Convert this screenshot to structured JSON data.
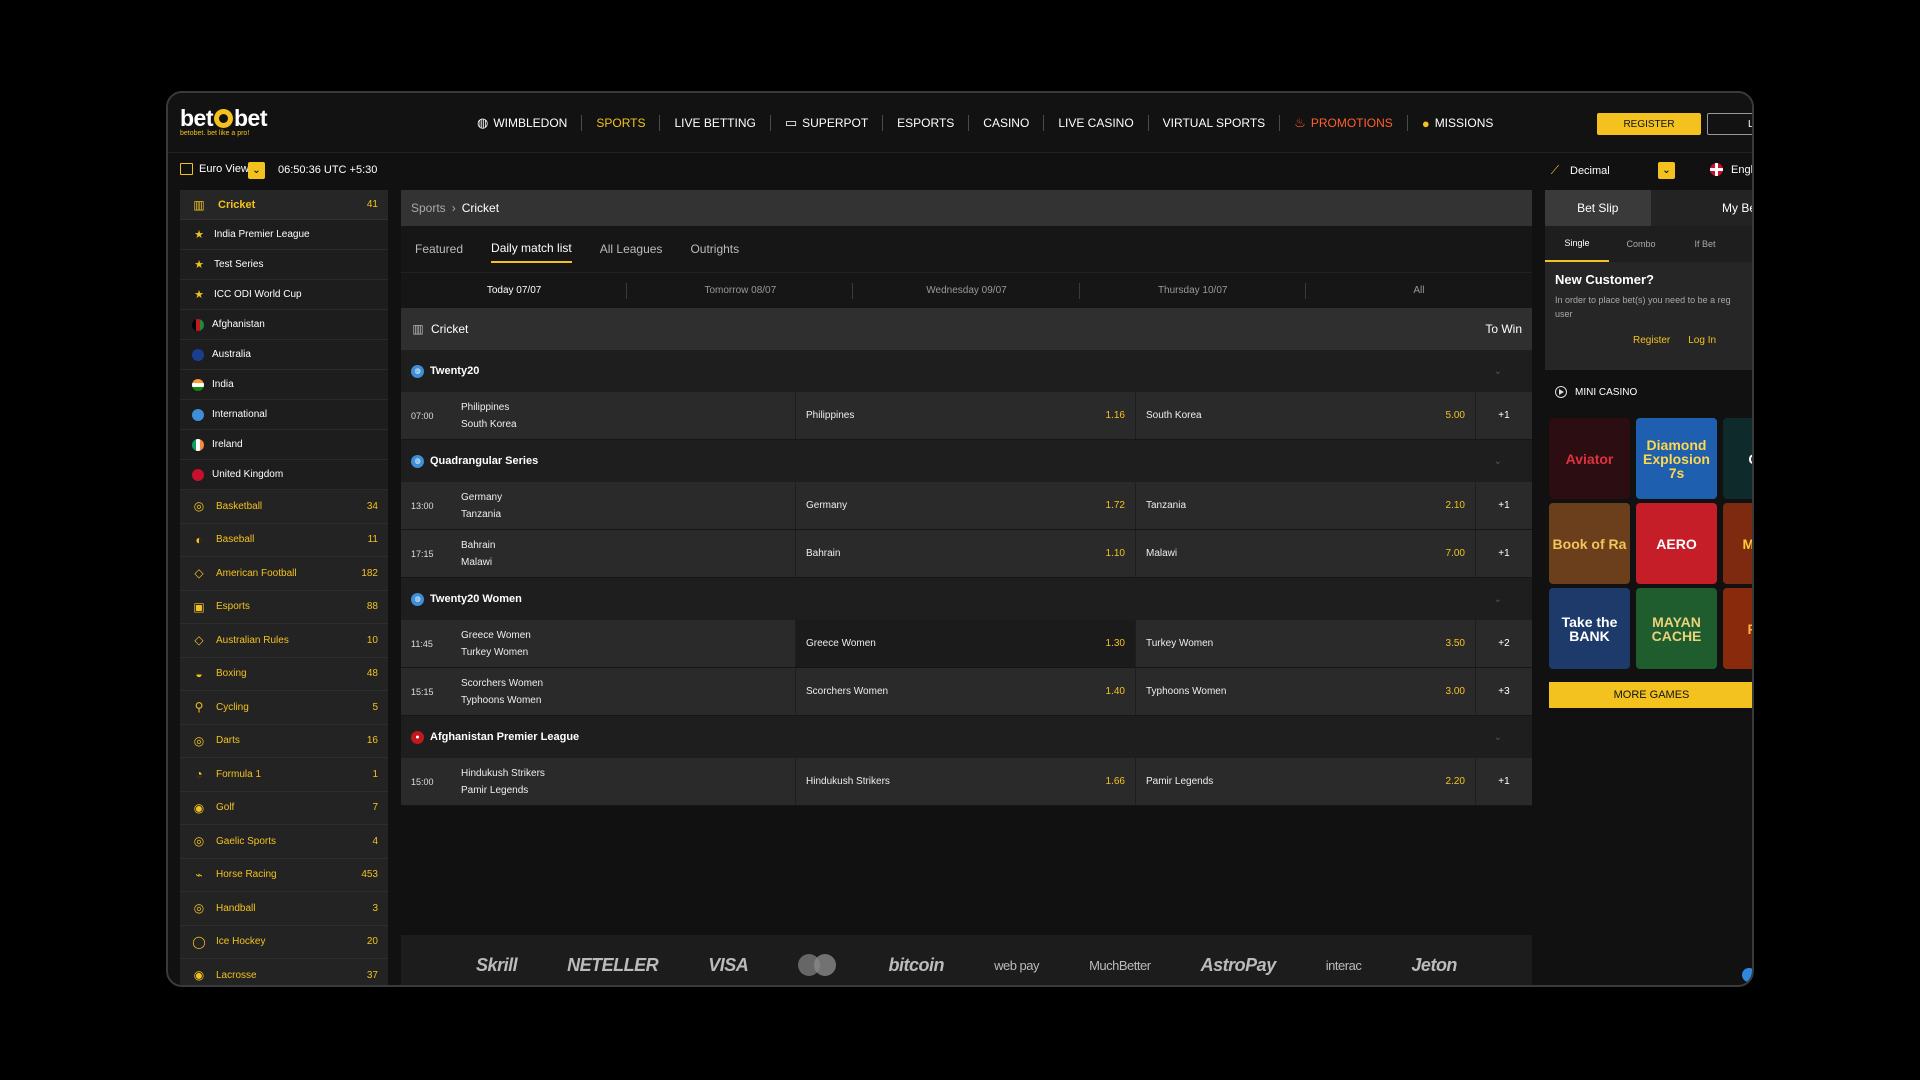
{
  "brand": {
    "name": "betobet",
    "name_left": "bet",
    "name_right": "bet",
    "tagline": "betobet. bet like a pro!",
    "accent": "#f3c21f"
  },
  "nav": [
    {
      "label": "WIMBLEDON",
      "icon": "tennis-ball-icon"
    },
    {
      "label": "SPORTS",
      "active": true
    },
    {
      "label": "LIVE BETTING"
    },
    {
      "label": "SUPERPOT",
      "icon": "ticket-icon"
    },
    {
      "label": "ESPORTS"
    },
    {
      "label": "CASINO"
    },
    {
      "label": "LIVE CASINO"
    },
    {
      "label": "VIRTUAL SPORTS"
    },
    {
      "label": "PROMOTIONS",
      "icon": "flame-icon",
      "color": "#ff5f2e"
    },
    {
      "label": "MISSIONS",
      "icon": "coin-icon"
    }
  ],
  "auth": {
    "register": "REGISTER",
    "login": "LO"
  },
  "subbar": {
    "view": "Euro View",
    "time": "06:50:36 UTC +5:30",
    "odds_format": "Decimal",
    "language": "Engli"
  },
  "sidebar": {
    "current": {
      "name": "Cricket",
      "count": "41",
      "icon": "cricket-icon"
    },
    "subitems": [
      {
        "name": "India Premier League",
        "icon": "star-icon"
      },
      {
        "name": "Test Series",
        "icon": "star-icon"
      },
      {
        "name": "ICC ODI World Cup",
        "icon": "star-icon"
      },
      {
        "name": "Afghanistan",
        "icon": "flag-afghanistan-icon"
      },
      {
        "name": "Australia",
        "icon": "flag-australia-icon"
      },
      {
        "name": "India",
        "icon": "flag-india-icon"
      },
      {
        "name": "International",
        "icon": "globe-icon"
      },
      {
        "name": "Ireland",
        "icon": "flag-ireland-icon"
      },
      {
        "name": "United Kingdom",
        "icon": "flag-uk-icon"
      }
    ],
    "sports": [
      {
        "name": "Basketball",
        "count": "34",
        "icon": "basketball-icon"
      },
      {
        "name": "Baseball",
        "count": "11",
        "icon": "baseball-icon"
      },
      {
        "name": "American Football",
        "count": "182",
        "icon": "american-football-icon"
      },
      {
        "name": "Esports",
        "count": "88",
        "icon": "gamepad-icon"
      },
      {
        "name": "Australian Rules",
        "count": "10",
        "icon": "aussie-rules-icon"
      },
      {
        "name": "Boxing",
        "count": "48",
        "icon": "boxing-glove-icon"
      },
      {
        "name": "Cycling",
        "count": "5",
        "icon": "bicycle-icon"
      },
      {
        "name": "Darts",
        "count": "16",
        "icon": "dartboard-icon"
      },
      {
        "name": "Formula 1",
        "count": "1",
        "icon": "formula1-icon"
      },
      {
        "name": "Golf",
        "count": "7",
        "icon": "golf-ball-icon"
      },
      {
        "name": "Gaelic Sports",
        "count": "4",
        "icon": "gaelic-icon"
      },
      {
        "name": "Horse Racing",
        "count": "453",
        "icon": "horse-icon"
      },
      {
        "name": "Handball",
        "count": "3",
        "icon": "handball-icon"
      },
      {
        "name": "Ice Hockey",
        "count": "20",
        "icon": "ice-hockey-icon"
      },
      {
        "name": "Lacrosse",
        "count": "37",
        "icon": "lacrosse-icon"
      }
    ]
  },
  "main": {
    "breadcrumb": {
      "root": "Sports",
      "current": "Cricket"
    },
    "tabs": [
      {
        "label": "Featured"
      },
      {
        "label": "Daily match list",
        "active": true
      },
      {
        "label": "All Leagues"
      },
      {
        "label": "Outrights"
      }
    ],
    "dates": [
      {
        "label": "Today 07/07",
        "active": true
      },
      {
        "label": "Tomorrow 08/07"
      },
      {
        "label": "Wednesday 09/07"
      },
      {
        "label": "Thursday 10/07"
      },
      {
        "label": "All"
      }
    ],
    "sport_header": {
      "name": "Cricket",
      "market": "To Win"
    },
    "leagues": [
      {
        "name": "Twenty20",
        "badge": "globe-icon",
        "matches": [
          {
            "time": "07:00",
            "home": "Philippines",
            "away": "South Korea",
            "home_odds": "1.16",
            "away_odds": "5.00",
            "more": "+1"
          }
        ]
      },
      {
        "name": "Quadrangular Series",
        "badge": "globe-icon",
        "matches": [
          {
            "time": "13:00",
            "home": "Germany",
            "away": "Tanzania",
            "home_odds": "1.72",
            "away_odds": "2.10",
            "more": "+1"
          },
          {
            "time": "17:15",
            "home": "Bahrain",
            "away": "Malawi",
            "home_odds": "1.10",
            "away_odds": "7.00",
            "more": "+1"
          }
        ]
      },
      {
        "name": "Twenty20 Women",
        "badge": "globe-icon",
        "matches": [
          {
            "time": "11:45",
            "home": "Greece Women",
            "away": "Turkey Women",
            "home_odds": "1.30",
            "away_odds": "3.50",
            "more": "+2",
            "highlight": true
          },
          {
            "time": "15:15",
            "home": "Scorchers Women",
            "away": "Typhoons Women",
            "home_odds": "1.40",
            "away_odds": "3.00",
            "more": "+3"
          }
        ]
      },
      {
        "name": "Afghanistan Premier League",
        "badge": "flag-afghanistan-icon",
        "matches": [
          {
            "time": "15:00",
            "home": "Hindukush Strikers",
            "away": "Pamir Legends",
            "home_odds": "1.66",
            "away_odds": "2.20",
            "more": "+1"
          }
        ]
      }
    ],
    "payments": [
      "Skrill",
      "NETELLER",
      "VISA",
      "mastercard",
      "bitcoin",
      "web pay",
      "MuchBetter",
      "AstroPay",
      "interac",
      "Jeton"
    ]
  },
  "betslip": {
    "tabs": [
      "Bet Slip",
      "My Be"
    ],
    "types": [
      "Single",
      "Combo",
      "If Bet"
    ],
    "new_customer": {
      "title": "New Customer?",
      "line1": "In order to place bet(s) you need to be a reg",
      "line2": "user",
      "register": "Register",
      "login": "Log In"
    },
    "mini_casino": "MINI CASINO",
    "games": [
      {
        "title": "Aviator",
        "bg": "#2b0d12",
        "fg": "#e0323e"
      },
      {
        "title": "Diamond Explosion 7s",
        "bg": "#1f5fb0",
        "fg": "#ffd84a"
      },
      {
        "title": "CRA",
        "bg": "#0e2a2a",
        "fg": "#ffffff"
      },
      {
        "title": "Book of Ra",
        "bg": "#6b3f1c",
        "fg": "#f2c45a"
      },
      {
        "title": "AERO",
        "bg": "#c61e28",
        "fg": "#ffffff"
      },
      {
        "title": "Me Ho",
        "bg": "#7d2a10",
        "fg": "#ffcc33"
      },
      {
        "title": "Take the BANK",
        "bg": "#1e3a6b",
        "fg": "#ffffff"
      },
      {
        "title": "MAYAN CACHE",
        "bg": "#1f5c2e",
        "fg": "#e8d27a"
      },
      {
        "title": "FIRE",
        "bg": "#8a2a0c",
        "fg": "#ffb040"
      }
    ],
    "more_games": "MORE GAMES"
  }
}
